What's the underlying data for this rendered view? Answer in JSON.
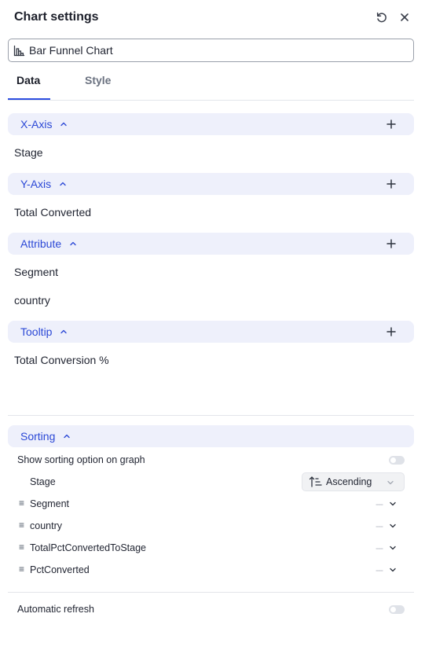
{
  "header": {
    "title": "Chart settings",
    "reset_icon": "reset-icon",
    "close_icon": "close-icon"
  },
  "chart_type": {
    "value": "Bar Funnel Chart",
    "icon": "bar-chart-icon"
  },
  "tabs": [
    {
      "label": "Data",
      "active": true
    },
    {
      "label": "Style",
      "active": false
    }
  ],
  "sections": {
    "x_axis": {
      "label": "X-Axis",
      "fields": [
        "Stage"
      ]
    },
    "y_axis": {
      "label": "Y-Axis",
      "fields": [
        "Total Converted"
      ]
    },
    "attribute": {
      "label": "Attribute",
      "fields": [
        "Segment",
        "country"
      ]
    },
    "tooltip": {
      "label": "Tooltip",
      "fields": [
        "Total Conversion %"
      ]
    }
  },
  "sorting": {
    "label": "Sorting",
    "show_option_label": "Show sorting option on graph",
    "show_option_enabled": false,
    "primary": {
      "name": "Stage",
      "direction": "Ascending"
    },
    "rows": [
      {
        "name": "Segment",
        "value": "---"
      },
      {
        "name": "country",
        "value": "---"
      },
      {
        "name": "TotalPctConvertedToStage",
        "value": "---"
      },
      {
        "name": "PctConverted",
        "value": "---"
      }
    ]
  },
  "auto_refresh": {
    "label": "Automatic refresh",
    "enabled": false
  },
  "colors": {
    "accent": "#2b48d6",
    "section_bg": "#eef0fb",
    "toggle_off": "#dfe2e8"
  }
}
